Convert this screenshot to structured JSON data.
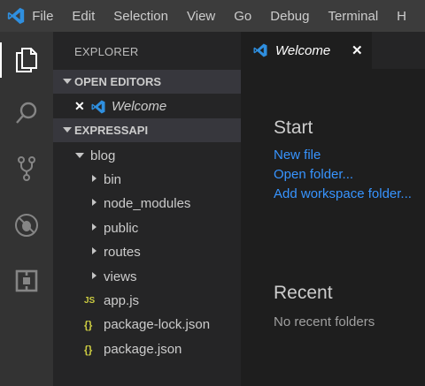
{
  "menubar": {
    "items": [
      {
        "label": "File"
      },
      {
        "label": "Edit"
      },
      {
        "label": "Selection"
      },
      {
        "label": "View"
      },
      {
        "label": "Go"
      },
      {
        "label": "Debug"
      },
      {
        "label": "Terminal"
      },
      {
        "label": "H"
      }
    ]
  },
  "activity_bar": {
    "items": [
      {
        "icon": "explorer-icon"
      },
      {
        "icon": "search-icon"
      },
      {
        "icon": "source-control-icon"
      },
      {
        "icon": "debug-icon"
      },
      {
        "icon": "extensions-icon"
      }
    ]
  },
  "sidebar": {
    "title": "EXPLORER",
    "open_editors": {
      "label": "OPEN EDITORS",
      "items": [
        {
          "label": "Welcome"
        }
      ]
    },
    "project": {
      "label": "EXPRESSAPI",
      "tree": {
        "folder": "blog",
        "subfolders": [
          "bin",
          "node_modules",
          "public",
          "routes",
          "views"
        ],
        "files": [
          {
            "name": "app.js",
            "badge": "JS"
          },
          {
            "name": "package-lock.json",
            "badge": "{}"
          },
          {
            "name": "package.json",
            "badge": "{}"
          }
        ]
      }
    }
  },
  "editor": {
    "tab": {
      "label": "Welcome",
      "close": "✕"
    },
    "start": {
      "heading": "Start",
      "links": [
        "New file",
        "Open folder...",
        "Add workspace folder..."
      ]
    },
    "recent": {
      "heading": "Recent",
      "empty": "No recent folders"
    }
  },
  "colors": {
    "accent": "#3794ff",
    "menubar_bg": "#3c3c3c",
    "activity_bg": "#333333",
    "sidebar_bg": "#252526",
    "editor_bg": "#1e1e1e"
  }
}
